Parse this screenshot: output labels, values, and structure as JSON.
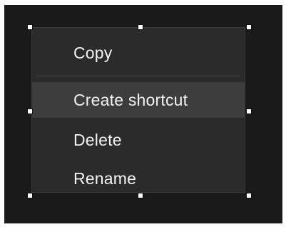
{
  "context_menu": {
    "items": [
      {
        "label": "Copy"
      },
      {
        "label": "Create shortcut"
      },
      {
        "label": "Delete"
      },
      {
        "label": "Rename"
      }
    ],
    "highlighted_item": "Create shortcut",
    "colors": {
      "background": "#2b2b2b",
      "highlight": "#3d3d3d",
      "text": "#f2f2f2",
      "separator": "#4a4a4a"
    }
  }
}
